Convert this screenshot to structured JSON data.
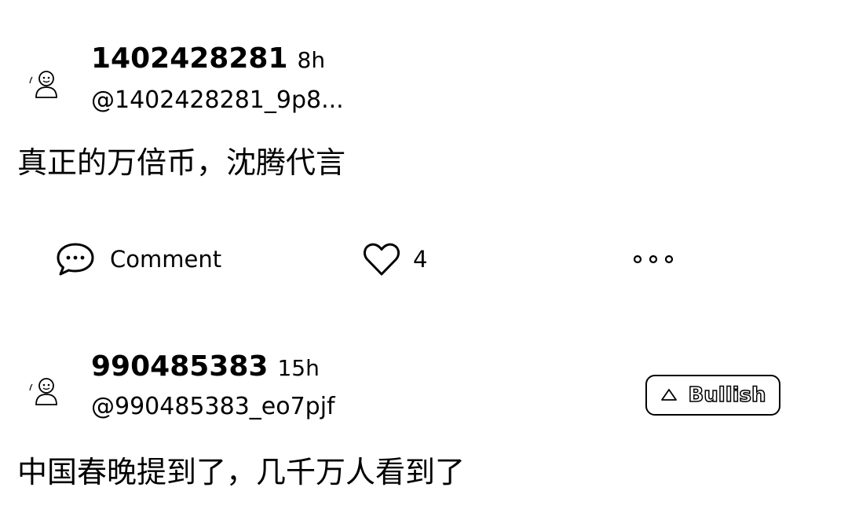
{
  "colors": {
    "background": "#ffffff",
    "text": "#000000"
  },
  "posts": [
    {
      "username": "1402428281",
      "time": "8h",
      "handle": "@1402428281_9p8...",
      "content": "真正的万倍币，沈腾代言",
      "avatar_icon": "default-avatar-icon",
      "actions": {
        "comment_label": "Comment",
        "comment_icon": "comment-bubble-icon",
        "like_icon": "heart-icon",
        "like_count": "4",
        "more_icon": "more-dots-icon"
      }
    },
    {
      "username": "990485383",
      "time": "15h",
      "handle": "@990485383_eo7pjf",
      "content": "中国春晚提到了，几千万人看到了",
      "avatar_icon": "default-avatar-icon",
      "sentiment": {
        "label": "Bullish",
        "icon": "triangle-up-icon"
      }
    }
  ]
}
